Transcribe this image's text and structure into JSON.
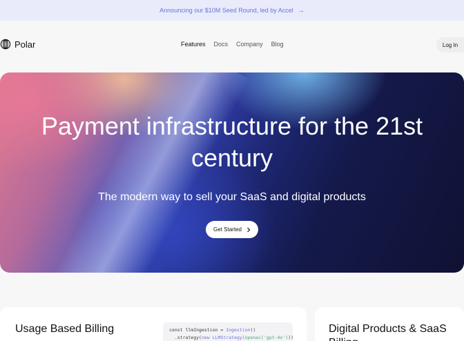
{
  "announcement": {
    "text": "Announcing our $10M Seed Round, led by Accel",
    "arrow": "→"
  },
  "nav": {
    "brand": "Polar",
    "links": [
      "Features",
      "Docs",
      "Company",
      "Blog"
    ],
    "login": "Log In"
  },
  "hero": {
    "title": "Payment infrastructure for the 21st century",
    "subtitle": "The modern way to sell your SaaS and digital products",
    "cta": "Get Started",
    "cta_icon": "chevron-right-icon"
  },
  "cards": {
    "usage": {
      "title": "Usage Based Billing",
      "code": {
        "line1_a": "const llmIngestion = ",
        "line1_b": "Ingestion",
        "line1_c": "()",
        "line2_a": "  .strategy(",
        "line2_b": "new LLMStrategy(",
        "line2_c": "openai('gpt-4o')",
        "line2_d": "))"
      }
    },
    "digital": {
      "title": "Digital Products & SaaS Billing"
    }
  },
  "colors": {
    "accent": "#6a72d9",
    "announce_bg": "#e9ebfb"
  }
}
